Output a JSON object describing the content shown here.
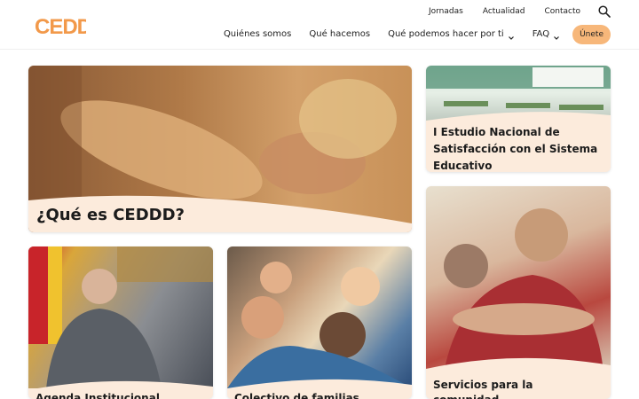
{
  "logo": {
    "text": "CEDDD",
    "color": "#f2994a"
  },
  "top_links": [
    "Jornadas",
    "Actualidad",
    "Contacto"
  ],
  "nav": {
    "items": [
      {
        "label": "Quiénes somos",
        "has_dropdown": false
      },
      {
        "label": "Qué hacemos",
        "has_dropdown": false
      },
      {
        "label": "Qué podemos hacer por ti",
        "has_dropdown": true
      },
      {
        "label": "FAQ",
        "has_dropdown": true
      }
    ],
    "join_label": "Únete",
    "join_color": "#f7b77a"
  },
  "cards": {
    "main": {
      "title": "¿Qué es CEDDD?"
    },
    "study": {
      "title": "I Estudio Nacional de Satisfacción con el Sistema Educativo"
    },
    "services": {
      "title": "Servicios para la comunidad"
    },
    "agenda": {
      "title": "Agenda Institucional"
    },
    "family": {
      "title": "Colectivo de familias"
    }
  },
  "colors": {
    "card_background": "#fcebdc",
    "accent": "#f7b77a"
  }
}
